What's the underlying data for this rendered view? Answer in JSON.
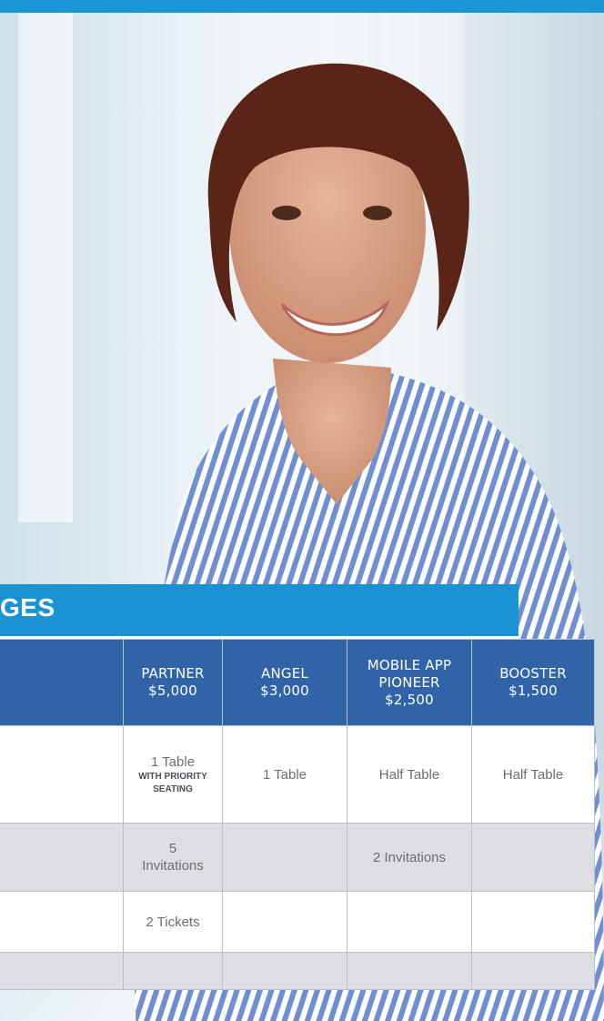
{
  "page": {
    "accent": "#1b96d4",
    "header_fill": "#3163a8"
  },
  "section": {
    "title": "GES"
  },
  "table": {
    "columns": [
      {
        "name": "",
        "price": ""
      },
      {
        "name": "Partner",
        "price": "$5,000"
      },
      {
        "name": "Angel",
        "price": "$3,000"
      },
      {
        "name": "Mobile App Pioneer",
        "price": "$2,500"
      },
      {
        "name": "Booster",
        "price": "$1,500"
      }
    ],
    "rows": [
      {
        "cells": [
          "",
          "1 Table",
          "1 Table",
          "Half Table",
          "Half Table"
        ],
        "partner_note": "With priority seating"
      },
      {
        "cells": [
          "",
          "5 Invitations",
          "",
          "2 Invitations",
          ""
        ]
      },
      {
        "cells": [
          "",
          "2 Tickets",
          "",
          "",
          ""
        ]
      },
      {
        "cells": [
          "",
          "",
          "",
          "",
          ""
        ]
      }
    ]
  }
}
